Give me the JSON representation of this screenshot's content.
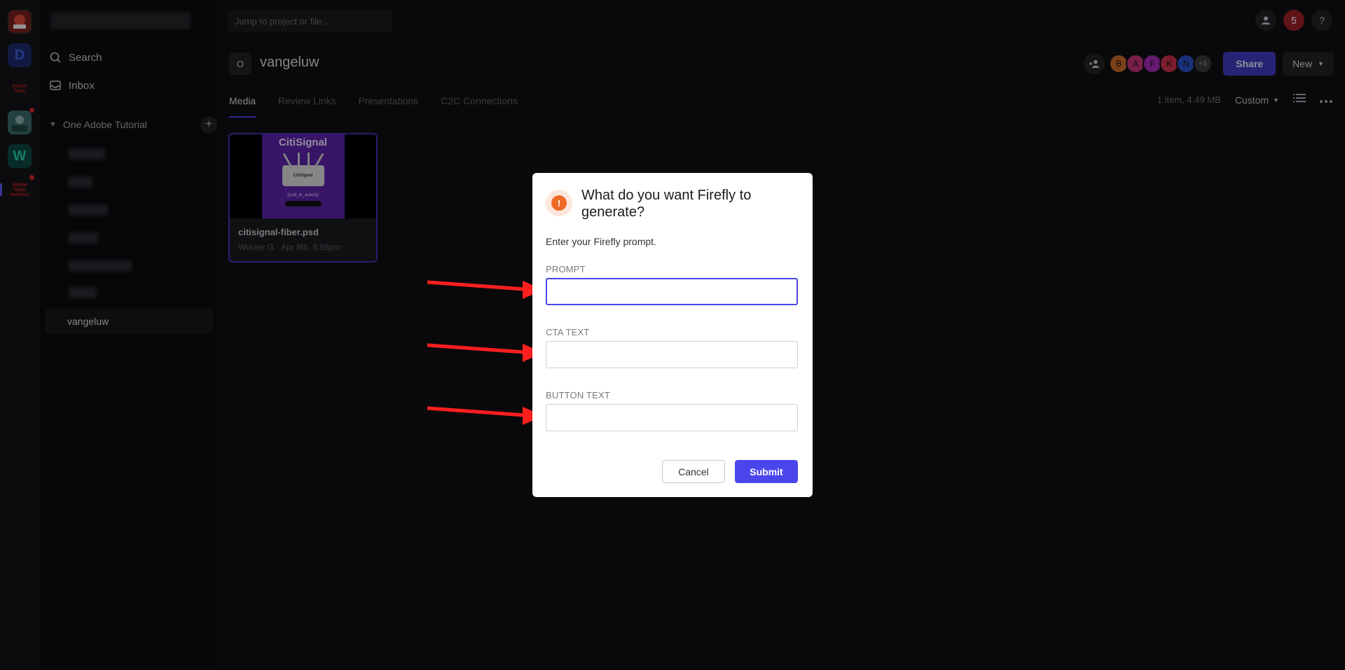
{
  "topbar": {
    "jump_placeholder": "Jump to project or file...",
    "notifications_count": "5",
    "help_label": "?"
  },
  "rail": {
    "items": [
      {
        "icon": "workspace-logo-icon"
      },
      {
        "label": "D"
      },
      {
        "label": "Adobe Team"
      },
      {
        "icon": "image-avatar-icon"
      },
      {
        "label": "W"
      },
      {
        "label": "Adobe Team Insiders"
      }
    ]
  },
  "sidebar": {
    "search_label": "Search",
    "inbox_label": "Inbox",
    "section_title": "One Adobe Tutorial",
    "selected_project": "vangeluw"
  },
  "project": {
    "icon_letter": "O",
    "title": "vangeluw",
    "avatars": [
      {
        "letter": "B",
        "color": "#c46a2a"
      },
      {
        "letter": "A",
        "color": "#c2337a"
      },
      {
        "letter": "F",
        "color": "#a62bb8"
      },
      {
        "letter": "K",
        "color": "#c8304a"
      },
      {
        "letter": "N",
        "color": "#2a4fc4"
      },
      {
        "letter": "+3",
        "color": "#3a3a40"
      }
    ],
    "share_label": "Share",
    "new_label": "New"
  },
  "tabs": [
    {
      "label": "Media",
      "active": true
    },
    {
      "label": "Review Links",
      "active": false
    },
    {
      "label": "Presentations",
      "active": false
    },
    {
      "label": "C2C Connections",
      "active": false
    }
  ],
  "toolbar": {
    "item_info": "1 item, 4.49 MB",
    "sort_label": "Custom"
  },
  "asset": {
    "thumb_brand": "CitiSignal",
    "thumb_router_text": "CitiSignal",
    "thumb_cta": "{{call_to_action}}",
    "name": "citisignal-fiber.psd",
    "meta": "Wouter G · Apr 8th, 6:58pm"
  },
  "dialog": {
    "title": "What do you want Firefly to generate?",
    "description": "Enter your Firefly prompt.",
    "fields": [
      {
        "label": "PROMPT",
        "value": "",
        "focused": true
      },
      {
        "label": "CTA TEXT",
        "value": "",
        "focused": false
      },
      {
        "label": "BUTTON TEXT",
        "value": "",
        "focused": false
      }
    ],
    "cancel_label": "Cancel",
    "submit_label": "Submit"
  },
  "colors": {
    "accent": "#4b46ec",
    "alert": "#ee6a26",
    "arrow": "#ff1f1f"
  }
}
